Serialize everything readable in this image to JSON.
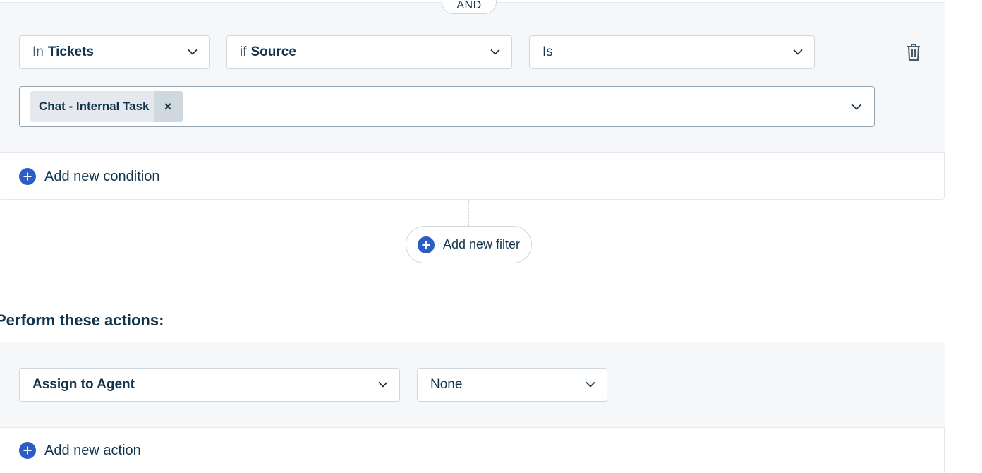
{
  "conditions": {
    "operator_badge": "AND",
    "module_select": {
      "prefix": "In",
      "value": "Tickets"
    },
    "field_select": {
      "prefix": "if",
      "value": "Source"
    },
    "operator_select": {
      "value": "Is"
    },
    "selected_values": [
      {
        "label": "Chat - Internal Task",
        "remove_icon": "×"
      }
    ],
    "add_condition_label": "Add new condition"
  },
  "add_filter_label": "Add new filter",
  "actions": {
    "title": "Perform these actions:",
    "action_select": {
      "value": "Assign to Agent"
    },
    "value_select": {
      "value": "None"
    },
    "add_action_label": "Add new action"
  },
  "icons": {
    "trash": "trash-icon",
    "chevron": "chevron-down-icon",
    "plus": "plus-circle-icon"
  },
  "colors": {
    "accent": "#2c5cc5",
    "panel_bg": "#f5f7f9",
    "border": "#cfd7df",
    "text": "#12344d"
  }
}
